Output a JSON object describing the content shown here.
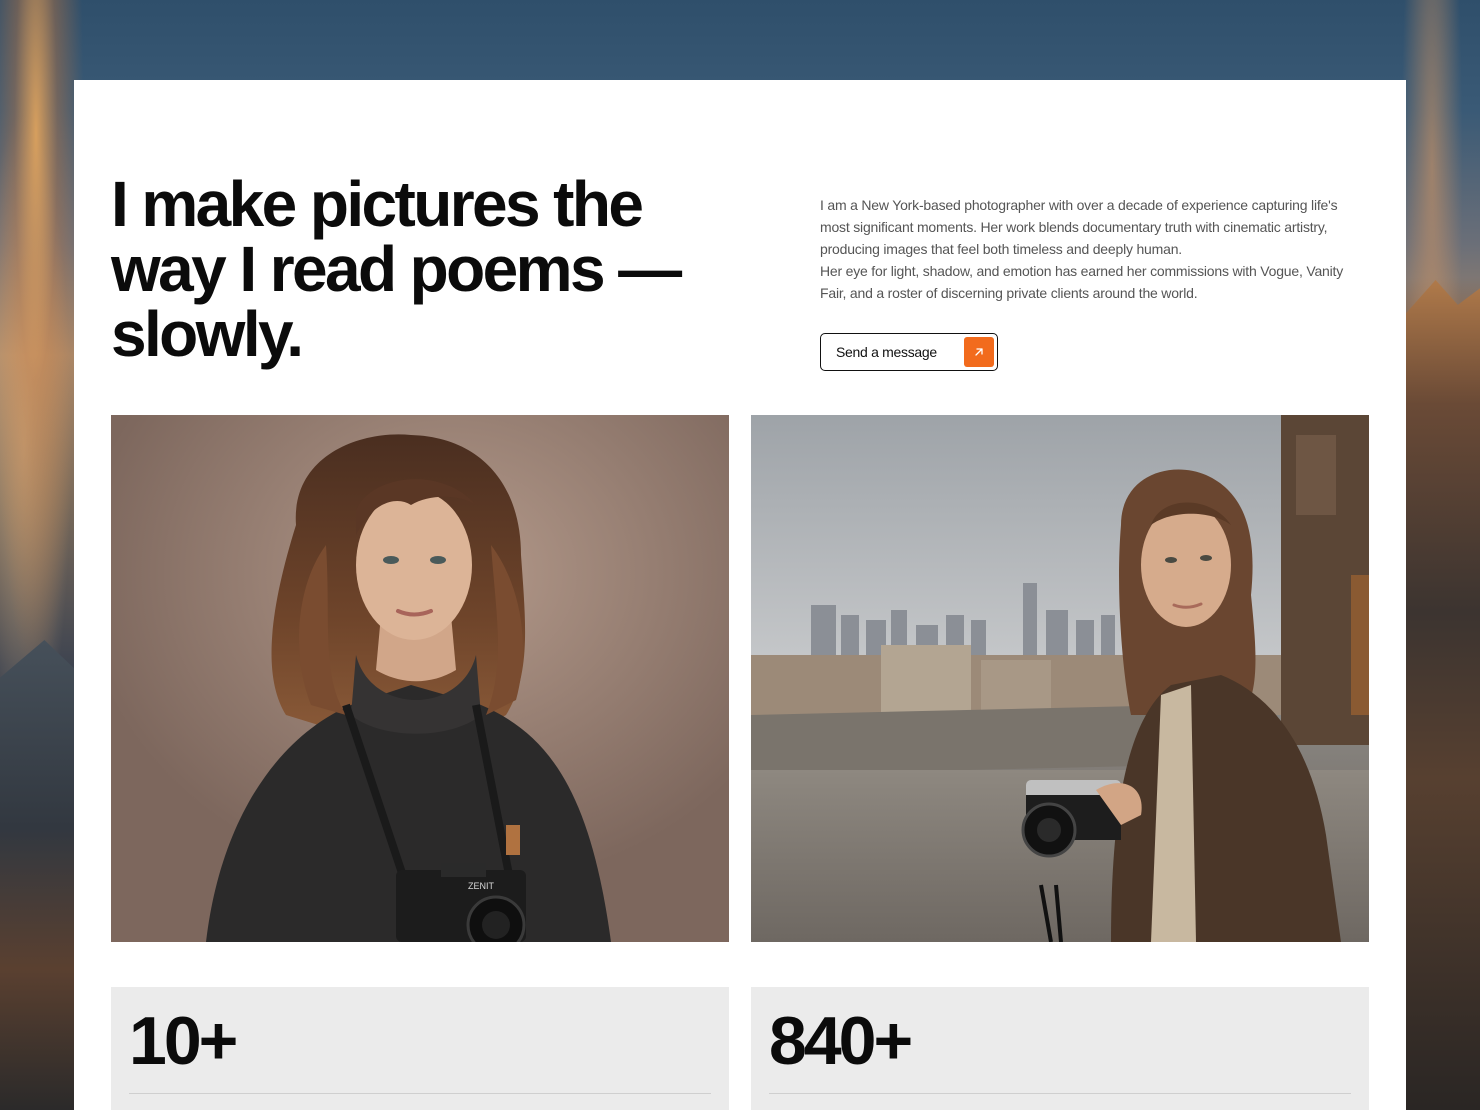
{
  "hero": {
    "headline": "I make pictures the way I read poems — slowly.",
    "intro_1": "I am a New York-based photographer with over a decade of experience capturing life's most significant moments. Her work blends documentary truth with cinematic artistry, producing images that feel both timeless and deeply human.",
    "intro_2": "Her eye for light, shadow, and emotion has earned her commissions with Vogue, Vanity Fair, and a roster of discerning private clients around the world.",
    "cta_label": "Send a message",
    "cta_icon": "arrow-up-right-icon"
  },
  "photos": {
    "camera_brand": "ZENIT"
  },
  "stats": [
    {
      "value": "10+"
    },
    {
      "value": "840+"
    }
  ],
  "colors": {
    "accent": "#f26b1d",
    "card": "#ffffff",
    "stat_bg": "#ebebeb"
  }
}
